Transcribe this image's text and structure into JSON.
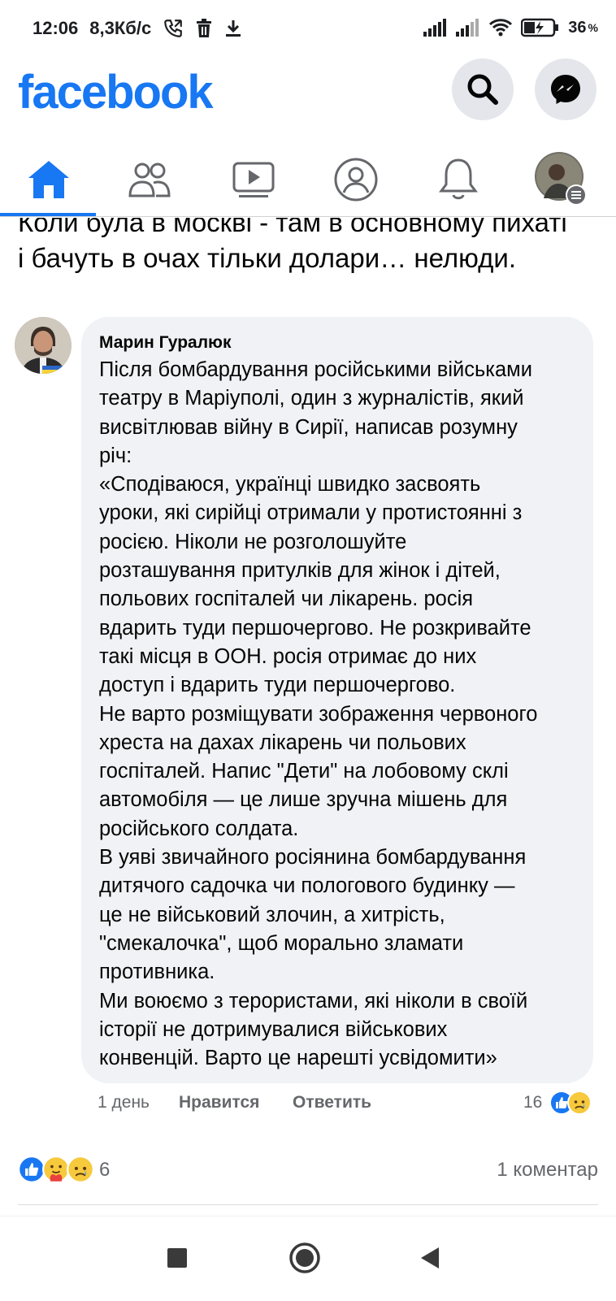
{
  "status_bar": {
    "time": "12:06",
    "speed": "8,3Кб/с",
    "battery": "36"
  },
  "header": {
    "logo": "facebook",
    "search_icon": "search-icon",
    "messenger_icon": "messenger-icon"
  },
  "tabs": [
    "home",
    "friends",
    "watch",
    "profile",
    "notifications",
    "menu"
  ],
  "previous_comment": {
    "line1": "Коли була в москві - там в основному пихаті",
    "line2": "і бачуть в очах тільки  долари… нелюди."
  },
  "comment": {
    "author": "Марин Гуралюк",
    "lines": [
      "Після бомбардування російськими військами",
      "театру в Маріуполі, один з журналістів, який",
      "висвітлював війну в Сирії, написав розумну",
      "річ:",
      "«Сподіваюся, українці швидко засвоять",
      "уроки, які сирійці отримали у протистоянні з",
      "росією. Ніколи не розголошуйте",
      "розташування притулків для жінок і дітей,",
      "польових госпіталей чи лікарень. росія",
      "вдарить туди першочергово. Не розкривайте",
      "такі місця в ООН. росія отримає до них",
      "доступ і вдарить туди першочергово.",
      "Не варто розміщувати зображення червоного",
      "хреста на дахах лікарень чи польових",
      "госпіталей. Напис \"Дети\" на лобовому склі",
      "автомобіля — це лише зручна мішень для",
      "російського солдата.",
      "В уяві звичайного росіянина бомбардування",
      "дитячого садочка чи пологового будинку —",
      "це не військовий злочин, а хитрість,",
      "\"смекалочка\", щоб морально зламати",
      "противника.",
      "Ми воюємо з терористами, які ніколи в своїй",
      "історії не дотримувалися військових",
      "конвенцій. Варто це нарешті усвідомити»"
    ],
    "time": "1 день",
    "like_label": "Нравится",
    "reply_label": "Ответить",
    "reaction_count": "16"
  },
  "post_footer": {
    "reaction_count": "6",
    "comments_label": "1 коментар"
  },
  "colors": {
    "brand": "#1877f2",
    "bubble": "#f0f2f5",
    "muted": "#65676b"
  }
}
